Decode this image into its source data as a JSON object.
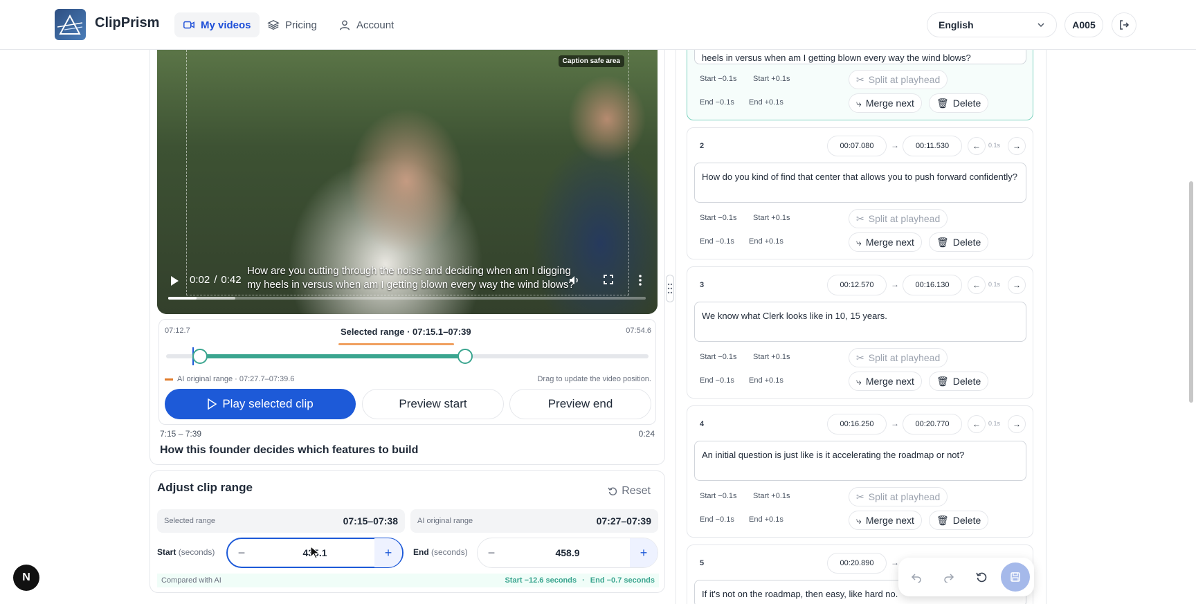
{
  "nav": {
    "brand": "ClipPrism",
    "items": [
      {
        "label": "My videos",
        "icon": "video-icon",
        "active": true
      },
      {
        "label": "Pricing",
        "icon": "layers-icon",
        "active": false
      },
      {
        "label": "Account",
        "icon": "user-icon",
        "active": false
      }
    ],
    "language": "English",
    "user": "A005"
  },
  "player": {
    "safe_area_label": "Caption safe area",
    "caption": "How are you cutting through the noise and deciding when am I digging my heels in versus when am I getting blown every way the wind blows?",
    "time_current": "0:02",
    "time_sep": "/",
    "time_total": "0:42",
    "progress_fraction": 0.06,
    "buffered_fraction": 0.14
  },
  "trim": {
    "left_time": "07:12.7",
    "right_time": "07:54.6",
    "selected_label": "Selected range · 07:15.1–07:39",
    "ai_range_label": "AI original range · 07:27.7–07:39.6",
    "drag_hint": "Drag to update the video position.",
    "play_selected": "Play selected clip",
    "preview_start": "Preview start",
    "preview_end": "Preview end"
  },
  "clip": {
    "range": "7:15 – 7:39",
    "duration": "0:24",
    "title": "How this founder decides which features to build"
  },
  "adjust": {
    "title": "Adjust clip range",
    "reset": "Reset",
    "selected_range_label": "Selected range",
    "selected_range_value": "07:15–07:38",
    "ai_range_label": "AI original range",
    "ai_range_value": "07:27–07:39",
    "start_label": "Start",
    "start_unit": "(seconds)",
    "start_value": "435.1",
    "end_label": "End",
    "end_unit": "(seconds)",
    "end_value": "458.9",
    "compared_label": "Compared with AI",
    "start_delta": "Start −12.6 seconds",
    "dot": "·",
    "end_delta": "End −0.7 seconds"
  },
  "segment_common": {
    "start_minus": "Start −0.1s",
    "start_plus": "Start +0.1s",
    "end_minus": "End −0.1s",
    "end_plus": "End +0.1s",
    "split": "Split at playhead",
    "merge": "Merge next",
    "delete": "Delete",
    "step": "0.1s"
  },
  "segments": [
    {
      "num": "1",
      "start": "",
      "end": "",
      "text": "heels in versus when am I getting blown every way the wind blows?"
    },
    {
      "num": "2",
      "start": "00:07.080",
      "end": "00:11.530",
      "text": "How do you kind of find that center that allows you to push forward confidently?"
    },
    {
      "num": "3",
      "start": "00:12.570",
      "end": "00:16.130",
      "text": "We know what Clerk looks like in 10, 15 years."
    },
    {
      "num": "4",
      "start": "00:16.250",
      "end": "00:20.770",
      "text": "An initial question is just like is it accelerating the roadmap or not?"
    },
    {
      "num": "5",
      "start": "00:20.890",
      "end": "",
      "text": "If it's not on the roadmap, then easy, like hard no."
    }
  ],
  "colors": {
    "accent": "#1d5ad8",
    "teal": "#3aa58f",
    "orange": "#f0a060"
  }
}
